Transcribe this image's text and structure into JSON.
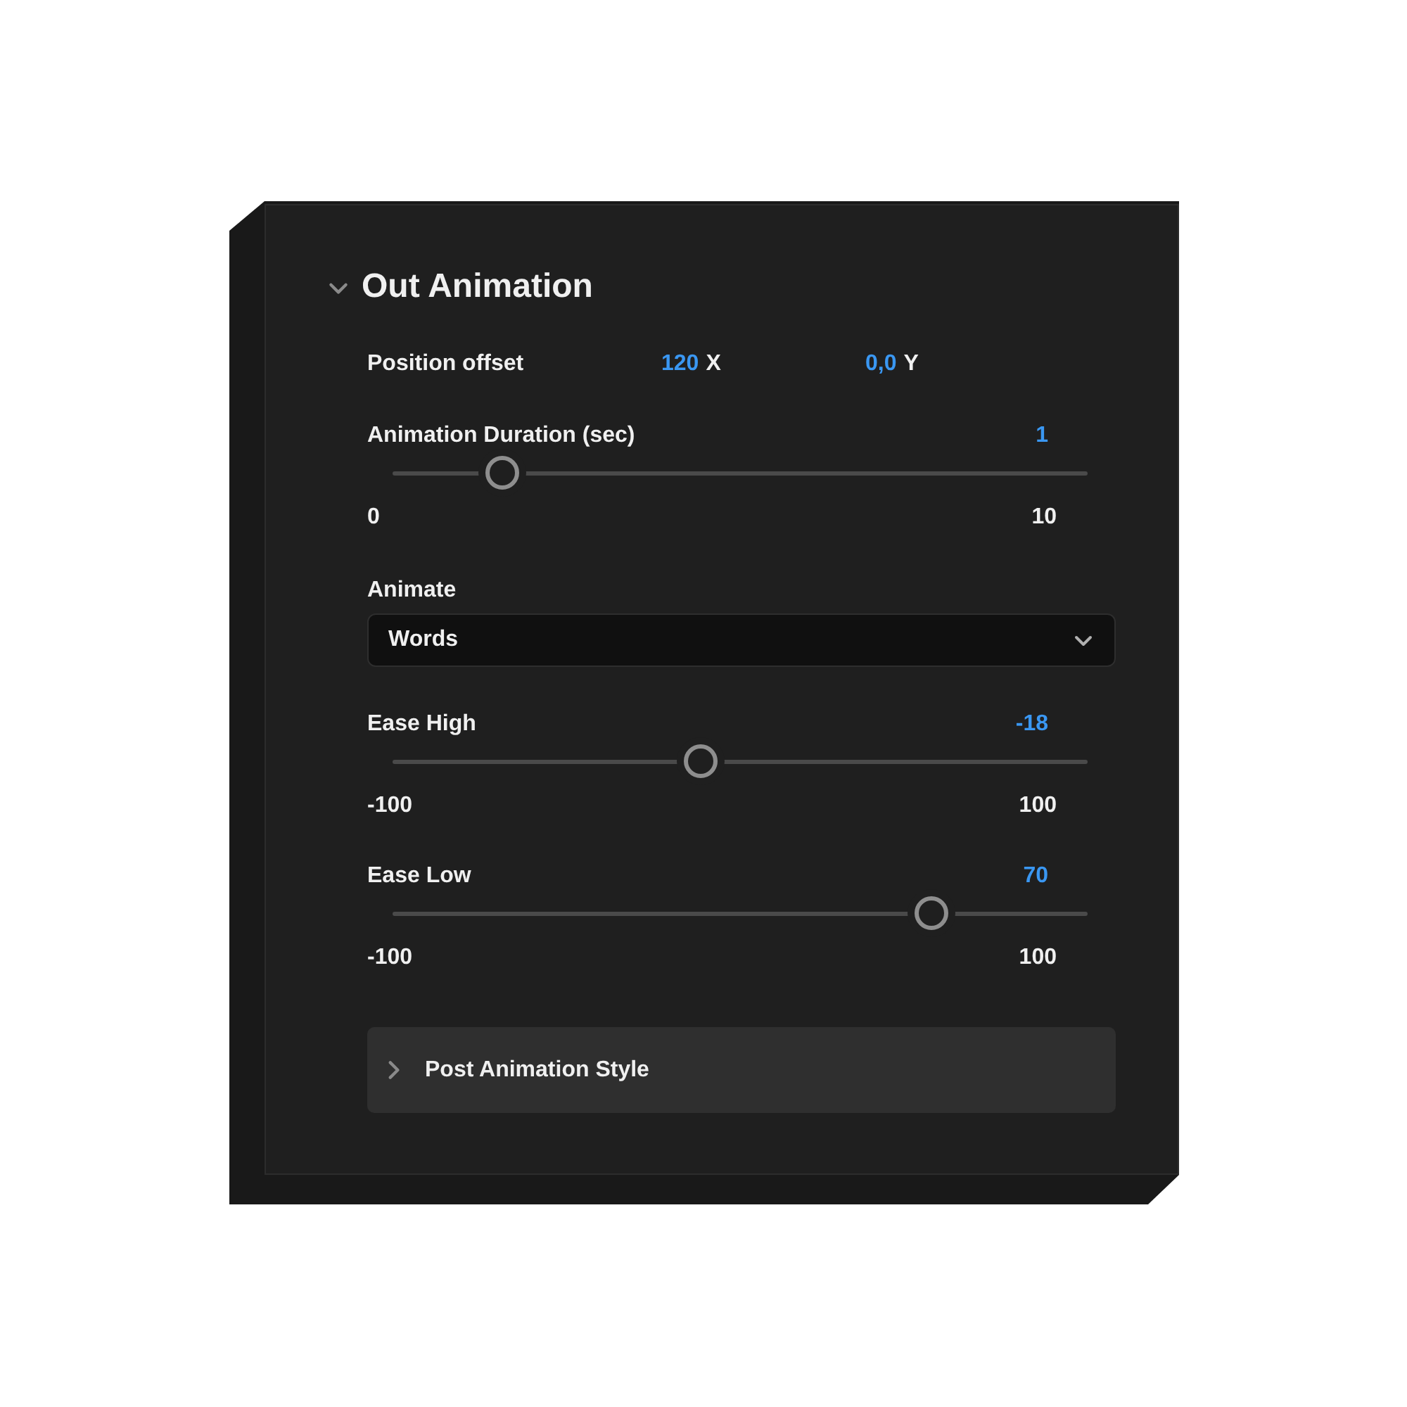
{
  "section": {
    "title": "Out Animation",
    "expanded": true
  },
  "position_offset": {
    "label": "Position offset",
    "x": {
      "value": "120",
      "axis": "X"
    },
    "y": {
      "value": "0,0",
      "axis": "Y"
    }
  },
  "controls": [
    {
      "kind": "slider",
      "label": "Animation Duration (sec)",
      "value": "1",
      "min": "0",
      "max": "10",
      "level": 0.14
    },
    {
      "kind": "dropdown",
      "label": "Animate",
      "value": "Words"
    },
    {
      "kind": "slider",
      "label": "Ease High",
      "value": "-18",
      "min": "-100",
      "max": "100",
      "level": 0.44
    },
    {
      "kind": "slider",
      "label": "Ease Low",
      "value": "70",
      "min": "-100",
      "max": "100",
      "level": 0.79
    }
  ],
  "subsection": {
    "title": "Post Animation Style",
    "expanded": false
  }
}
